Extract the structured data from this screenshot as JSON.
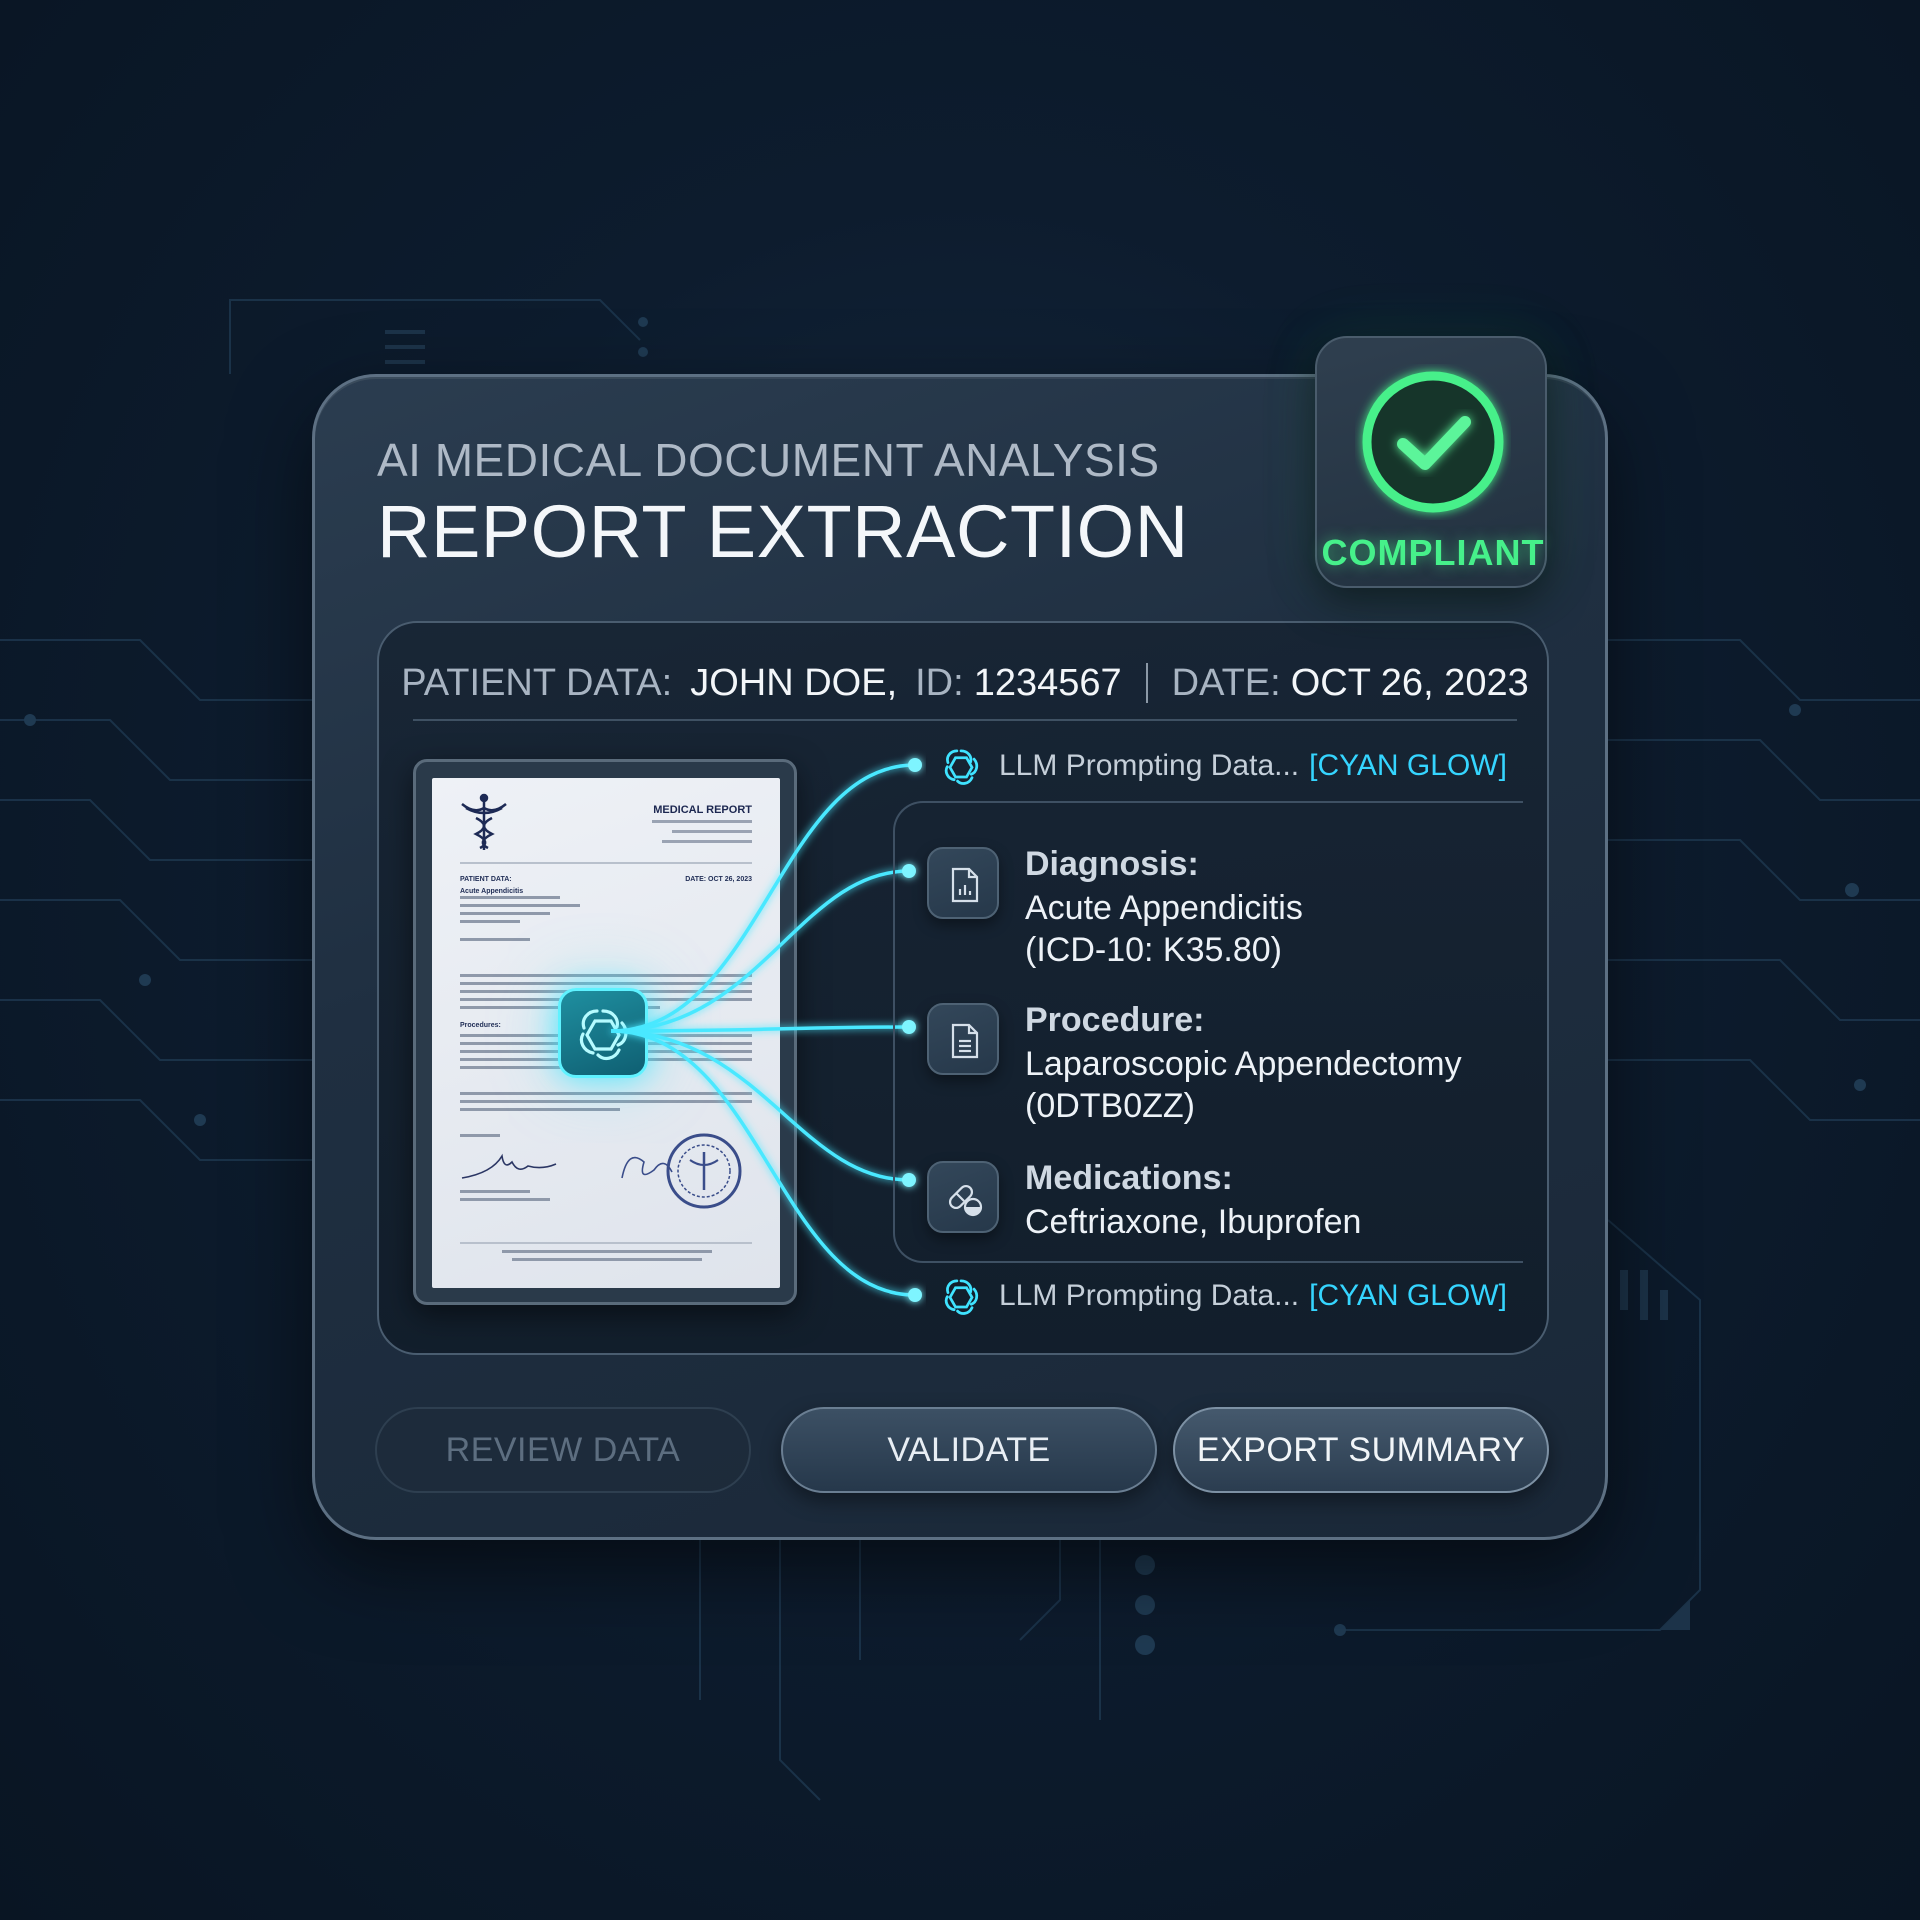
{
  "header": {
    "subtitle": "AI MEDICAL DOCUMENT ANALYSIS",
    "title": "REPORT EXTRACTION"
  },
  "status_badge": {
    "label": "COMPLIANT",
    "icon": "check-circle-icon",
    "color": "#46f08a"
  },
  "patient_bar": {
    "patient_key": "PATIENT DATA:",
    "patient_name": "JOHN DOE,",
    "id_key": "ID:",
    "id_value": "1234567",
    "date_key": "DATE:",
    "date_value": "OCT 26, 2023"
  },
  "document": {
    "title": "MEDICAL REPORT",
    "patient_label": "PATIENT DATA:",
    "date_label": "DATE: OCT 26, 2023",
    "section_diagnosis": "Acute Appendicitis",
    "section_procedure_line": "Lapaorsopic Appendectomy",
    "procedures_heading": "Procedures:"
  },
  "llm_rows": [
    {
      "text": "LLM Prompting Data...",
      "tag": "[CYAN GLOW]",
      "icon": "ai-knot-icon"
    },
    {
      "text": "LLM Prompting Data...",
      "tag": "[CYAN GLOW]",
      "icon": "ai-knot-icon"
    }
  ],
  "results": [
    {
      "label": "Diagnosis:",
      "value_line1": "Acute Appendicitis",
      "value_line2": "(ICD-10: K35.80)",
      "icon": "document-chart-icon"
    },
    {
      "label": "Procedure:",
      "value_line1": "Laparoscopic Appendectomy",
      "value_line2": "(0DTB0ZZ)",
      "icon": "document-lines-icon"
    },
    {
      "label": "Medications:",
      "value_line1": "Ceftriaxone, Ibuprofen",
      "value_line2": "",
      "icon": "pill-icon"
    }
  ],
  "buttons": {
    "review": "REVIEW DATA",
    "validate": "VALIDATE",
    "export": "EXPORT SUMMARY"
  },
  "colors": {
    "accent_cyan": "#35d5ff",
    "compliant_green": "#46f08a",
    "panel": "#1f2f41"
  }
}
